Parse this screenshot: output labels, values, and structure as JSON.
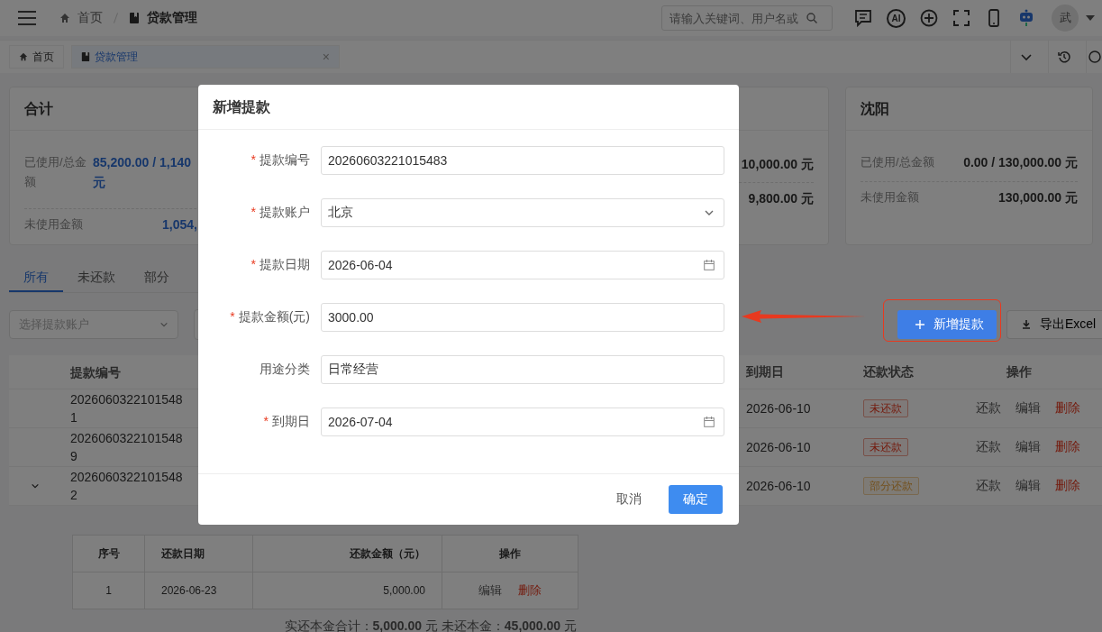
{
  "header": {
    "breadcrumb": [
      "首页",
      "贷款管理"
    ],
    "search": {
      "placeholder": "请输入关键词、用户名或"
    },
    "ai_label": "AI",
    "avatar": "武"
  },
  "tab_bar": {
    "tabs": [
      {
        "label": "首页",
        "selected": false,
        "closable": false
      },
      {
        "label": "贷款管理",
        "selected": true,
        "closable": true,
        "close": "×"
      }
    ]
  },
  "summary_cards": [
    {
      "title": "合计",
      "rows": [
        {
          "label": "已使用/总金额",
          "value_lines": [
            "85,200.00 / 1,140",
            "元"
          ]
        },
        {
          "label": "未使用金额",
          "value_lines": [
            "1,054,"
          ]
        }
      ]
    },
    {
      "rows": [
        {
          "value_lines": [
            "10,000.00 元"
          ]
        },
        {
          "value_lines": [
            "9,800.00 元"
          ]
        }
      ]
    },
    {
      "title": "沈阳",
      "rows": [
        {
          "label": "已使用/总金额",
          "value_lines": [
            "0.00 / 130,000.00 元"
          ]
        },
        {
          "label": "未使用金额",
          "value_lines": [
            "130,000.00 元"
          ]
        }
      ]
    }
  ],
  "filter_tabs": [
    {
      "label": "所有",
      "selected": true
    },
    {
      "label": "未还款",
      "selected": false
    },
    {
      "label": "部分",
      "selected": false
    }
  ],
  "account_select": {
    "placeholder": "选择提款账户"
  },
  "toolbar": [
    {
      "label": "新增提款",
      "kind": "primary"
    },
    {
      "label": "导出Excel",
      "kind": "export"
    }
  ],
  "table": {
    "columns": [
      "提款编号",
      "到期日",
      "还款状态",
      "操作"
    ],
    "rows": [
      {
        "id": "20260603221015481",
        "has_details": false,
        "due": "2026-06-10",
        "status": {
          "label": "未还款",
          "kind": "unpaid"
        },
        "actions": [
          "还款",
          "编辑",
          "删除"
        ]
      },
      {
        "id": "20260603221015489",
        "has_details": false,
        "due": "2026-06-10",
        "status": {
          "label": "未还款",
          "kind": "unpaid"
        },
        "actions": [
          "还款",
          "编辑",
          "删除"
        ]
      },
      {
        "id": "20260603221015482",
        "has_details": true,
        "due": "2026-06-10",
        "status": {
          "label": "部分还款",
          "kind": "partial"
        },
        "actions": [
          "还款",
          "编辑",
          "删除"
        ]
      }
    ]
  },
  "repayments": {
    "columns": [
      "序号",
      "还款日期",
      "还款金额（元）",
      "操作"
    ],
    "rows": [
      {
        "index": "1",
        "date": "2026-06-23",
        "amount": "5,000.00",
        "actions": [
          "编辑",
          "删除"
        ]
      }
    ],
    "summary": "实还本金合计：**5,000.00** 元   未还本金：**45,000.00** 元"
  },
  "dialog": {
    "title": "新增提款",
    "fields": [
      {
        "label": "提款编号",
        "required": true,
        "kind": "text",
        "value": "20260603221015483"
      },
      {
        "label": "提款账户",
        "required": true,
        "kind": "select",
        "value": "北京"
      },
      {
        "label": "提款日期",
        "required": true,
        "kind": "date",
        "value": "2026-06-04"
      },
      {
        "label": "提款金额(元)",
        "required": true,
        "kind": "text",
        "value": "3000.00"
      },
      {
        "label": "用途分类",
        "required": false,
        "kind": "text",
        "value": "日常经营"
      },
      {
        "label": "到期日",
        "required": true,
        "kind": "date",
        "value": "2026-07-04"
      }
    ],
    "buttons": [
      {
        "label": "取消",
        "kind": "plain"
      },
      {
        "label": "确定",
        "kind": "primary"
      }
    ],
    "required_mark": "*"
  }
}
